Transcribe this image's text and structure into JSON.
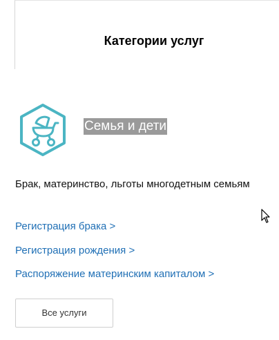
{
  "header": {
    "title": "Категории услуг"
  },
  "category": {
    "name": "Семья и дети",
    "icon": "baby-carriage-icon",
    "description": "Брак, материнство, льготы многодетным семьям",
    "accent_color": "#4bb5c3",
    "links": [
      "Регистрация брака >",
      "Регистрация рождения >",
      "Распоряжение материнским капиталом >"
    ]
  },
  "actions": {
    "all_services_label": "Все услуги"
  }
}
